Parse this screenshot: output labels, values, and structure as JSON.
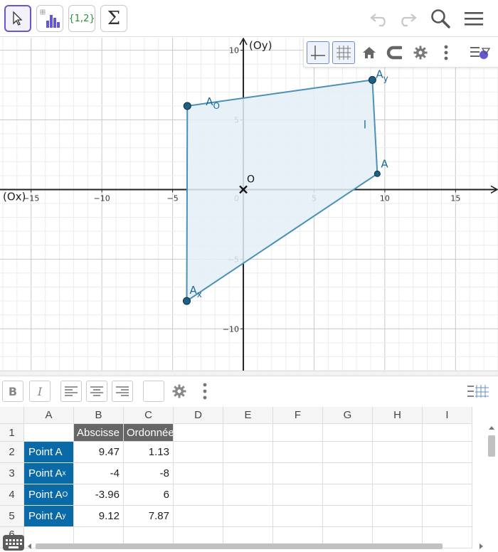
{
  "toolbar": {
    "tools": [
      {
        "name": "move-tool",
        "icon": "cursor-arrow-icon",
        "active": true
      },
      {
        "name": "statistics-tool",
        "icon": "bar-chart-icon"
      },
      {
        "name": "list-tool",
        "label": "{1,2}"
      },
      {
        "name": "sum-tool",
        "label": "Σ"
      }
    ],
    "right": [
      "undo-icon",
      "redo-icon",
      "search-icon",
      "menu-icon"
    ]
  },
  "graphics": {
    "x_axis_label": "(Ox)",
    "y_axis_label": "(Oy)",
    "origin_label": "O",
    "x_range": [
      -17.2,
      18.0
    ],
    "y_range": [
      -13.0,
      10.9
    ],
    "x_ticks": [
      -15,
      -10,
      -5,
      0,
      5,
      10,
      15
    ],
    "x_tick_labels": [
      "−15",
      "−10",
      "−5",
      "0",
      "5",
      "10",
      "15"
    ],
    "y_ticks": [
      -10,
      -5,
      5,
      10
    ],
    "y_tick_labels": [
      "−10",
      "−5",
      "5",
      "10"
    ],
    "polygon_label": "l",
    "points": [
      {
        "name": "A",
        "sub": "",
        "x": 9.47,
        "y": 1.13
      },
      {
        "name": "A",
        "sub": "x",
        "x": -4,
        "y": -8
      },
      {
        "name": "A",
        "sub": "O",
        "x": -3.96,
        "y": 6
      },
      {
        "name": "A",
        "sub": "y",
        "x": 9.12,
        "y": 7.87
      }
    ],
    "colors": {
      "polygon_stroke": "#4a90b8",
      "polygon_fill": "#e4eef6",
      "point": "#1f5f86",
      "label": "#1a6a9a"
    }
  },
  "style_bar": {
    "buttons": [
      "axes-toggle-icon",
      "grid-toggle-icon",
      "home-icon",
      "magnet-snap-icon",
      "settings-gear-icon",
      "more-vertical-icon",
      "style-bar-toggle-icon"
    ]
  },
  "sheet_bar": {
    "bold": "B",
    "italic": "I",
    "buttons": [
      "align-left-icon",
      "align-center-icon",
      "align-right-icon",
      "color-swatch",
      "settings-gear-icon",
      "more-vertical-icon",
      "sheet-layout-icon"
    ]
  },
  "sheet": {
    "columns": [
      "A",
      "B",
      "C",
      "D",
      "E",
      "F",
      "G",
      "H",
      "I"
    ],
    "rows": [
      "1",
      "2",
      "3",
      "4",
      "5",
      "6"
    ],
    "headers": {
      "B1": "Abscisse",
      "C1": "Ordonnée"
    },
    "data": [
      {
        "label": "Point A",
        "sub": "",
        "x": "9.47",
        "y": "1.13"
      },
      {
        "label": "Point A",
        "sub": "x",
        "x": "-4",
        "y": "-8"
      },
      {
        "label": "Point A",
        "sub": "O",
        "x": "-3.96",
        "y": "6"
      },
      {
        "label": "Point A",
        "sub": "y",
        "x": "9.12",
        "y": "7.87"
      }
    ]
  }
}
